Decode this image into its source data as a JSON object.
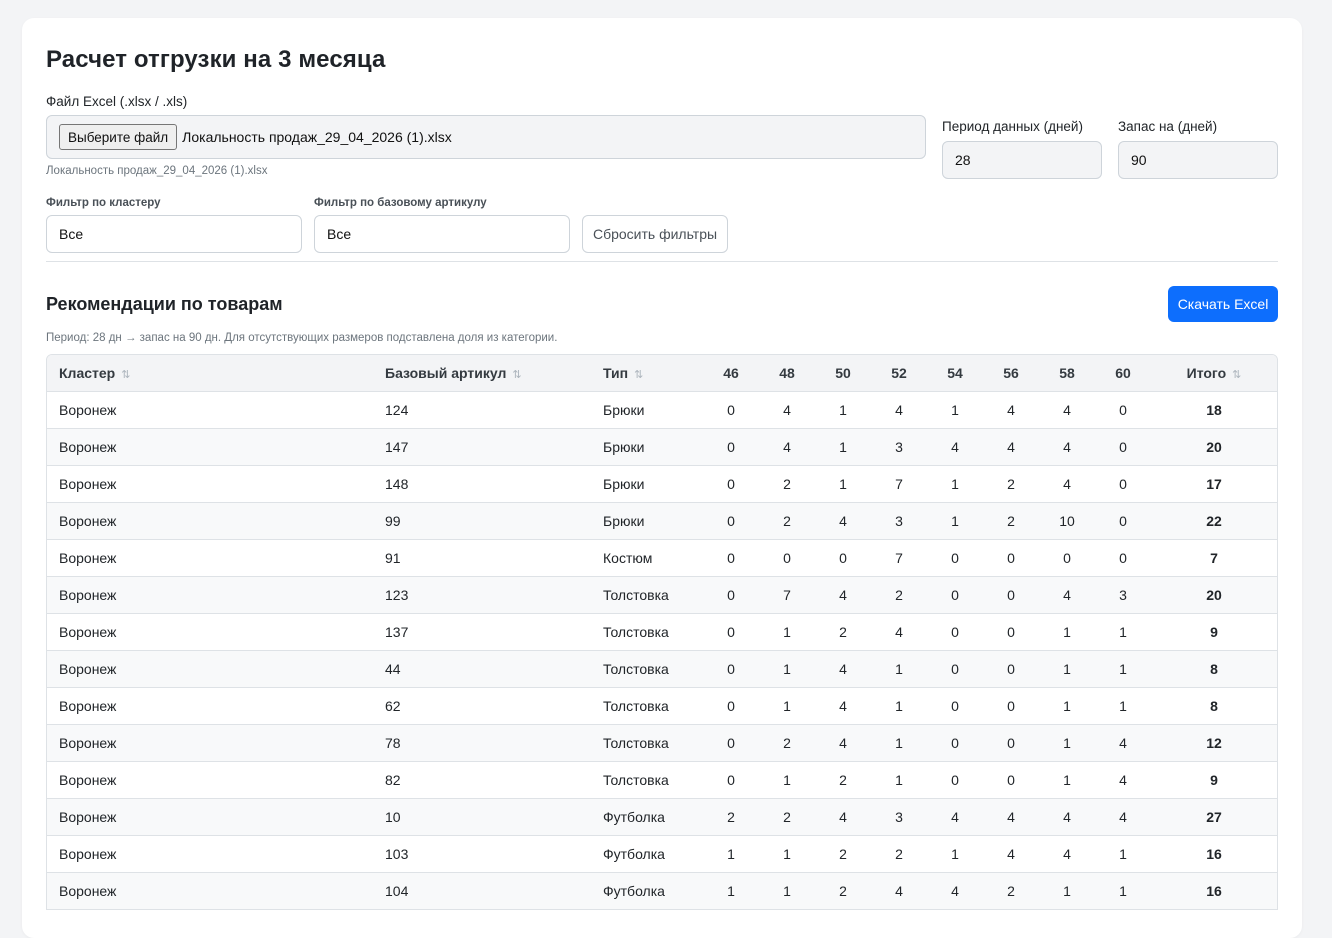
{
  "page": {
    "title": "Расчет отгрузки на 3 месяца"
  },
  "upload": {
    "label": "Файл Excel (.xlsx / .xls)",
    "button_label": "Выберите файл",
    "file_name": "Локальность продаж_29_04_2026 (1).xlsx",
    "hint": "Локальность продаж_29_04_2026 (1).xlsx"
  },
  "params": {
    "period_label": "Период данных (дней)",
    "period_value": "28",
    "stock_label": "Запас на (дней)",
    "stock_value": "90"
  },
  "filters": {
    "cluster_label": "Фильтр по кластеру",
    "cluster_value": "Все",
    "article_label": "Фильтр по базовому артикулу",
    "article_value": "Все",
    "reset_label": "Сбросить фильтры"
  },
  "recommendations": {
    "title": "Рекомендации по товарам",
    "download_label": "Скачать Excel",
    "note": "Период: 28 дн → запас на 90 дн. Для отсутствующих размеров подставлена доля из категории."
  },
  "colors": {
    "accent": "#0d6efd",
    "background": "#f3f4f6"
  },
  "table": {
    "columns": [
      "Кластер",
      "Базовый артикул",
      "Тип",
      "46",
      "48",
      "50",
      "52",
      "54",
      "56",
      "58",
      "60",
      "Итого"
    ],
    "sort_icon": "⇅",
    "rows": [
      [
        "Воронеж",
        "124",
        "Брюки",
        "0",
        "4",
        "1",
        "4",
        "1",
        "4",
        "4",
        "0",
        "18"
      ],
      [
        "Воронеж",
        "147",
        "Брюки",
        "0",
        "4",
        "1",
        "3",
        "4",
        "4",
        "4",
        "0",
        "20"
      ],
      [
        "Воронеж",
        "148",
        "Брюки",
        "0",
        "2",
        "1",
        "7",
        "1",
        "2",
        "4",
        "0",
        "17"
      ],
      [
        "Воронеж",
        "99",
        "Брюки",
        "0",
        "2",
        "4",
        "3",
        "1",
        "2",
        "10",
        "0",
        "22"
      ],
      [
        "Воронеж",
        "91",
        "Костюм",
        "0",
        "0",
        "0",
        "7",
        "0",
        "0",
        "0",
        "0",
        "7"
      ],
      [
        "Воронеж",
        "123",
        "Толстовка",
        "0",
        "7",
        "4",
        "2",
        "0",
        "0",
        "4",
        "3",
        "20"
      ],
      [
        "Воронеж",
        "137",
        "Толстовка",
        "0",
        "1",
        "2",
        "4",
        "0",
        "0",
        "1",
        "1",
        "9"
      ],
      [
        "Воронеж",
        "44",
        "Толстовка",
        "0",
        "1",
        "4",
        "1",
        "0",
        "0",
        "1",
        "1",
        "8"
      ],
      [
        "Воронеж",
        "62",
        "Толстовка",
        "0",
        "1",
        "4",
        "1",
        "0",
        "0",
        "1",
        "1",
        "8"
      ],
      [
        "Воронеж",
        "78",
        "Толстовка",
        "0",
        "2",
        "4",
        "1",
        "0",
        "0",
        "1",
        "4",
        "12"
      ],
      [
        "Воронеж",
        "82",
        "Толстовка",
        "0",
        "1",
        "2",
        "1",
        "0",
        "0",
        "1",
        "4",
        "9"
      ],
      [
        "Воронеж",
        "10",
        "Футболка",
        "2",
        "2",
        "4",
        "3",
        "4",
        "4",
        "4",
        "4",
        "27"
      ],
      [
        "Воронеж",
        "103",
        "Футболка",
        "1",
        "1",
        "2",
        "2",
        "1",
        "4",
        "4",
        "1",
        "16"
      ],
      [
        "Воронеж",
        "104",
        "Футболка",
        "1",
        "1",
        "2",
        "4",
        "4",
        "2",
        "1",
        "1",
        "16"
      ]
    ]
  }
}
